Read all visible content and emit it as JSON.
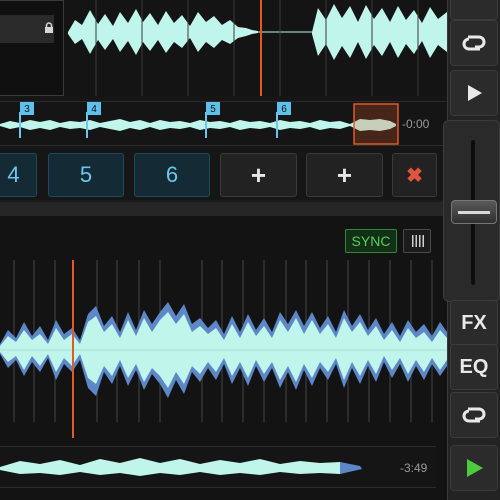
{
  "deck_top": {
    "remaining_time": "-0:00",
    "cue_markers": [
      "3",
      "4",
      "5",
      "6"
    ],
    "cue_buttons": [
      "4",
      "5",
      "6"
    ],
    "add_buttons": [
      "+",
      "+"
    ],
    "delete_button": "✖"
  },
  "deck_bottom": {
    "sync_label": "SYNC",
    "remaining_time": "-3:49"
  },
  "right_panel": {
    "fx_label": "FX",
    "eq_label": "EQ",
    "loop_icon_top": "loop-icon",
    "play_icon_top": "play-icon",
    "loop_icon_bottom": "loop-icon",
    "play_icon_bottom": "play-icon",
    "play_active_color": "#4ccc3a"
  },
  "colors": {
    "waveform": "#bff5ea",
    "waveform_shadow": "#5d87c7",
    "playhead": "#e05a2a",
    "cue": "#6cc7ee",
    "sync": "#54d05d"
  }
}
